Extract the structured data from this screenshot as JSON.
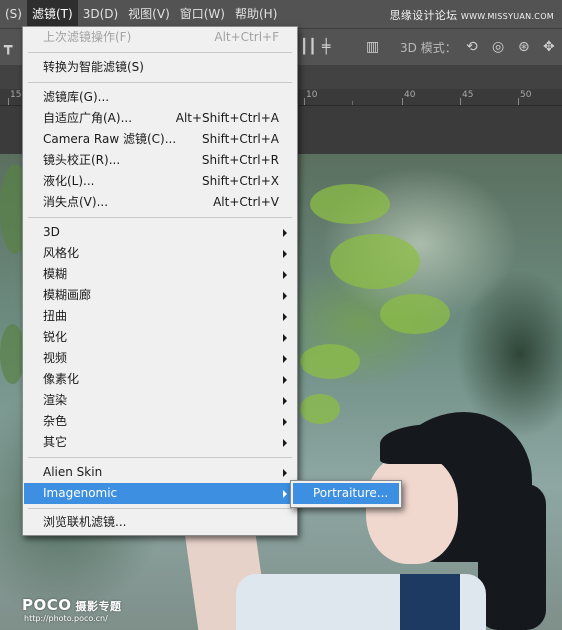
{
  "menubar": {
    "items": [
      "(S)",
      "滤镜(T)",
      "3D(D)",
      "视图(V)",
      "窗口(W)",
      "帮助(H)"
    ],
    "active_index": 1
  },
  "watermark": {
    "site_cn": "思缘设计论坛",
    "site_url": "WWW.MISSYUAN.COM"
  },
  "options_bar": {
    "mode_label": "3D 模式："
  },
  "ruler": {
    "labels": [
      "15",
      "10",
      "40",
      "45",
      "50"
    ]
  },
  "filter_menu": {
    "items": [
      {
        "label": "上次滤镜操作(F)",
        "shortcut": "Alt+Ctrl+F",
        "disabled": true
      },
      {
        "label": "转换为智能滤镜(S)",
        "shortcut": ""
      },
      {
        "label": "滤镜库(G)...",
        "shortcut": ""
      },
      {
        "label": "自适应广角(A)...",
        "shortcut": "Alt+Shift+Ctrl+A"
      },
      {
        "label": "Camera Raw 滤镜(C)...",
        "shortcut": "Shift+Ctrl+A"
      },
      {
        "label": "镜头校正(R)...",
        "shortcut": "Shift+Ctrl+R"
      },
      {
        "label": "液化(L)...",
        "shortcut": "Shift+Ctrl+X"
      },
      {
        "label": "消失点(V)...",
        "shortcut": "Alt+Ctrl+V"
      },
      {
        "label": "3D",
        "submenu": true
      },
      {
        "label": "风格化",
        "submenu": true
      },
      {
        "label": "模糊",
        "submenu": true
      },
      {
        "label": "模糊画廊",
        "submenu": true
      },
      {
        "label": "扭曲",
        "submenu": true
      },
      {
        "label": "锐化",
        "submenu": true
      },
      {
        "label": "视频",
        "submenu": true
      },
      {
        "label": "像素化",
        "submenu": true
      },
      {
        "label": "渲染",
        "submenu": true
      },
      {
        "label": "杂色",
        "submenu": true
      },
      {
        "label": "其它",
        "submenu": true
      },
      {
        "label": "Alien Skin",
        "submenu": true
      },
      {
        "label": "Imagenomic",
        "submenu": true,
        "highlighted": true
      },
      {
        "label": "浏览联机滤镜...",
        "shortcut": ""
      }
    ]
  },
  "imagenomic_submenu": {
    "items": [
      {
        "label": "Portraiture...",
        "highlighted": true
      }
    ]
  },
  "photo_watermark": {
    "brand": "POCO",
    "brand_cn": "摄影专题",
    "url": "http://photo.poco.cn/"
  },
  "colors": {
    "menu_bg": "#f0f0f0",
    "highlight": "#3d8fe2",
    "menubar_bg": "#535353"
  }
}
